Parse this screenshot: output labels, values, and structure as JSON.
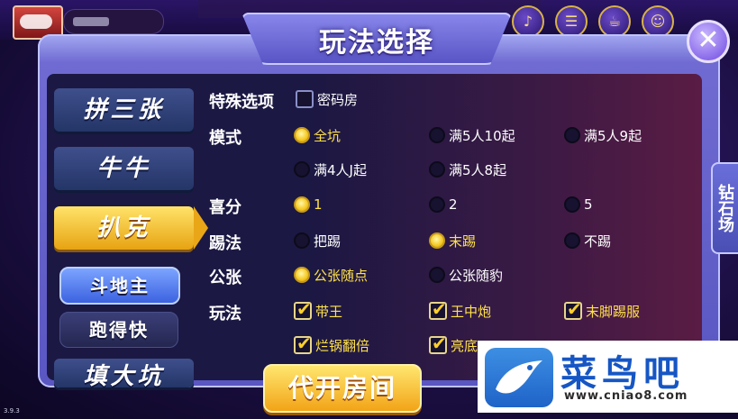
{
  "title": "玩法选择",
  "close_icon": "close-x-icon",
  "sidebar": {
    "items": [
      {
        "label": "拼三张",
        "active": false
      },
      {
        "label": "牛牛",
        "active": false
      },
      {
        "label": "扒克",
        "active": true
      },
      {
        "label": "填大坑",
        "active": false
      }
    ],
    "sub_items": [
      {
        "label": "斗地主",
        "active": true
      },
      {
        "label": "跑得快",
        "active": false
      }
    ]
  },
  "options": {
    "special": {
      "label": "特殊选项",
      "choices": [
        {
          "text": "密码房",
          "checked": false
        }
      ]
    },
    "mode": {
      "label": "模式",
      "choices": [
        {
          "text": "全坑",
          "selected": true
        },
        {
          "text": "满5人10起",
          "selected": false
        },
        {
          "text": "满5人9起",
          "selected": false
        },
        {
          "text": "满4人J起",
          "selected": false
        },
        {
          "text": "满5人8起",
          "selected": false
        }
      ]
    },
    "xifen": {
      "label": "喜分",
      "choices": [
        {
          "text": "1",
          "selected": true
        },
        {
          "text": "2",
          "selected": false
        },
        {
          "text": "5",
          "selected": false
        }
      ]
    },
    "kick": {
      "label": "踢法",
      "choices": [
        {
          "text": "把踢",
          "selected": false
        },
        {
          "text": "末踢",
          "selected": true
        },
        {
          "text": "不踢",
          "selected": false
        }
      ]
    },
    "public": {
      "label": "公张",
      "choices": [
        {
          "text": "公张随点",
          "selected": true
        },
        {
          "text": "公张随豹",
          "selected": false
        }
      ]
    },
    "play": {
      "label": "玩法",
      "choices": [
        {
          "text": "带王",
          "checked": true
        },
        {
          "text": "王中炮",
          "checked": true
        },
        {
          "text": "末脚踢服",
          "checked": true
        },
        {
          "text": "烂锅翻倍",
          "checked": true
        },
        {
          "text": "亮底",
          "checked": true
        }
      ]
    }
  },
  "right_tab": "钻石场",
  "open_room_button": "代开房间",
  "watermark": {
    "brand": "菜鸟吧",
    "url": "www.cniao8.com"
  },
  "version": "3.9.3"
}
